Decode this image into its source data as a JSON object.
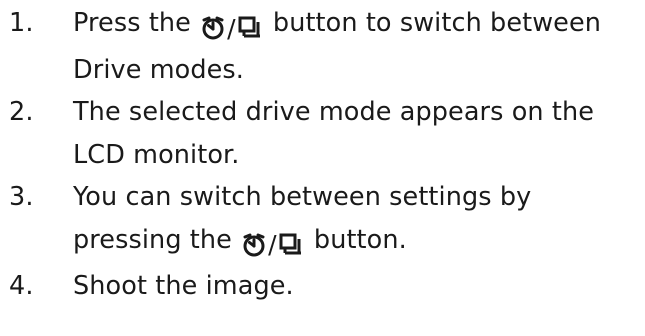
{
  "steps": [
    {
      "number": "1.",
      "before_icon": "Press the ",
      "after_icon": " button to switch between Drive modes.",
      "icon": "self-timer-continuous-button"
    },
    {
      "number": "2.",
      "text": "The selected drive mode appears on the LCD monitor."
    },
    {
      "number": "3.",
      "before_icon": "You can switch between settings by pressing the ",
      "after_icon": " button.",
      "icon": "self-timer-continuous-button"
    },
    {
      "number": "4.",
      "text": "Shoot the image."
    }
  ],
  "icon_separator": "/",
  "text_color": "#1a1a1a"
}
